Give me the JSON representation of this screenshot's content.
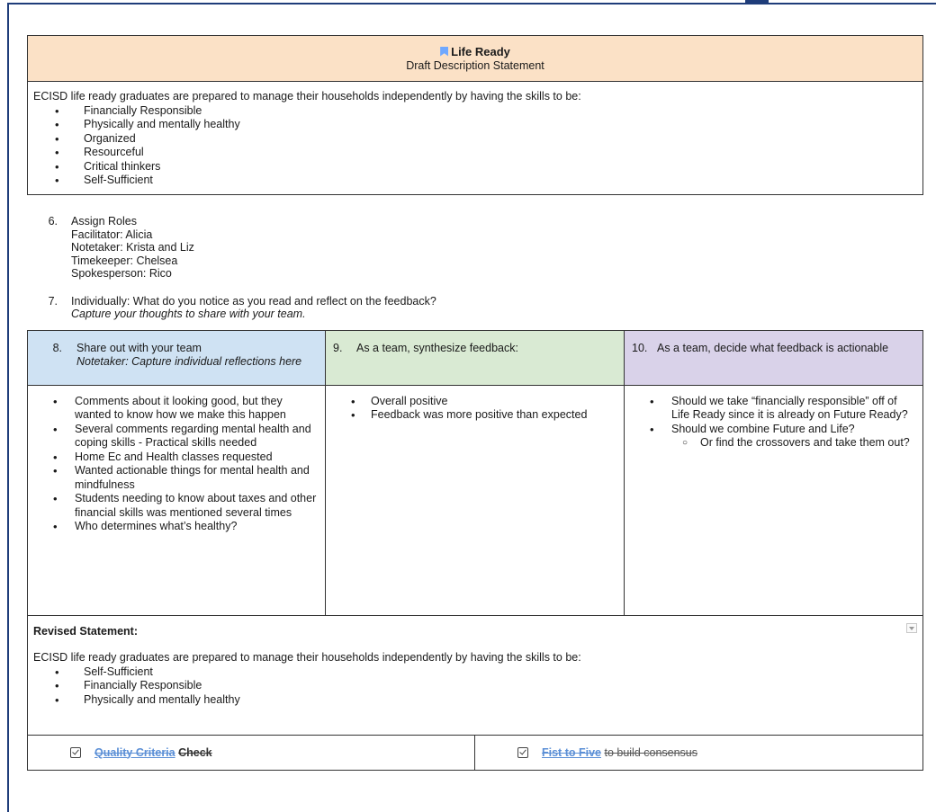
{
  "header": {
    "title": "Life Ready",
    "subtitle": "Draft Description Statement",
    "icon": "bookmark-icon",
    "bg_color": "#fbe1c6"
  },
  "description": {
    "intro": "ECISD life ready graduates are prepared to manage their households independently by having the skills to be:",
    "bullets": [
      "Financially Responsible",
      "Physically and mentally healthy",
      "Organized",
      "Resourceful",
      "Critical thinkers",
      "Self-Sufficient"
    ]
  },
  "steps": {
    "step6": {
      "num": "6.",
      "title": "Assign Roles",
      "roles": [
        "Facilitator: Alicia",
        "Notetaker: Krista and Liz",
        "Timekeeper: Chelsea",
        "Spokesperson: Rico"
      ]
    },
    "step7": {
      "num": "7.",
      "text": "Individually: What do you notice as you read and reflect on the feedback?",
      "italic": "Capture your thoughts to share with your team."
    }
  },
  "grid": {
    "col1": {
      "num": "8.",
      "title": "Share out with your team",
      "italic": "Notetaker: Capture individual reflections here",
      "color": "#cfe2f3",
      "bullets": [
        "Comments about it looking good, but they wanted to know how we make this happen",
        "Several comments regarding mental health and coping skills - Practical skills needed",
        "Home Ec and Health classes requested",
        "Wanted actionable things for mental health and mindfulness",
        "Students needing to know about taxes and other financial skills was mentioned several times",
        "Who determines what’s healthy?"
      ]
    },
    "col2": {
      "num": "9.",
      "title": "As a team, synthesize feedback:",
      "color": "#d9ead3",
      "bullets": [
        "Overall positive",
        "Feedback was more positive than expected"
      ]
    },
    "col3": {
      "num": "10.",
      "title": "As a team, decide what feedback is actionable",
      "color": "#d9d2e9",
      "bullets": [
        "Should we take “financially responsible” off of Life Ready since it is already on Future Ready?",
        "Should we combine Future and Life?"
      ],
      "sub_bullet": "Or find the crossovers and take them out?"
    }
  },
  "revised": {
    "title": "Revised Statement:",
    "intro": "ECISD life ready graduates are prepared to manage their households independently by having the skills to be:",
    "bullets": [
      "Self-Sufficient",
      "Financially Responsible",
      "Physically and mentally healthy"
    ]
  },
  "checks": {
    "left": {
      "link": "Quality Criteria",
      "rest": "Check"
    },
    "right": {
      "link": "Fist to Five",
      "rest": "to build consensus"
    },
    "link_color": "#5b8fd6"
  }
}
